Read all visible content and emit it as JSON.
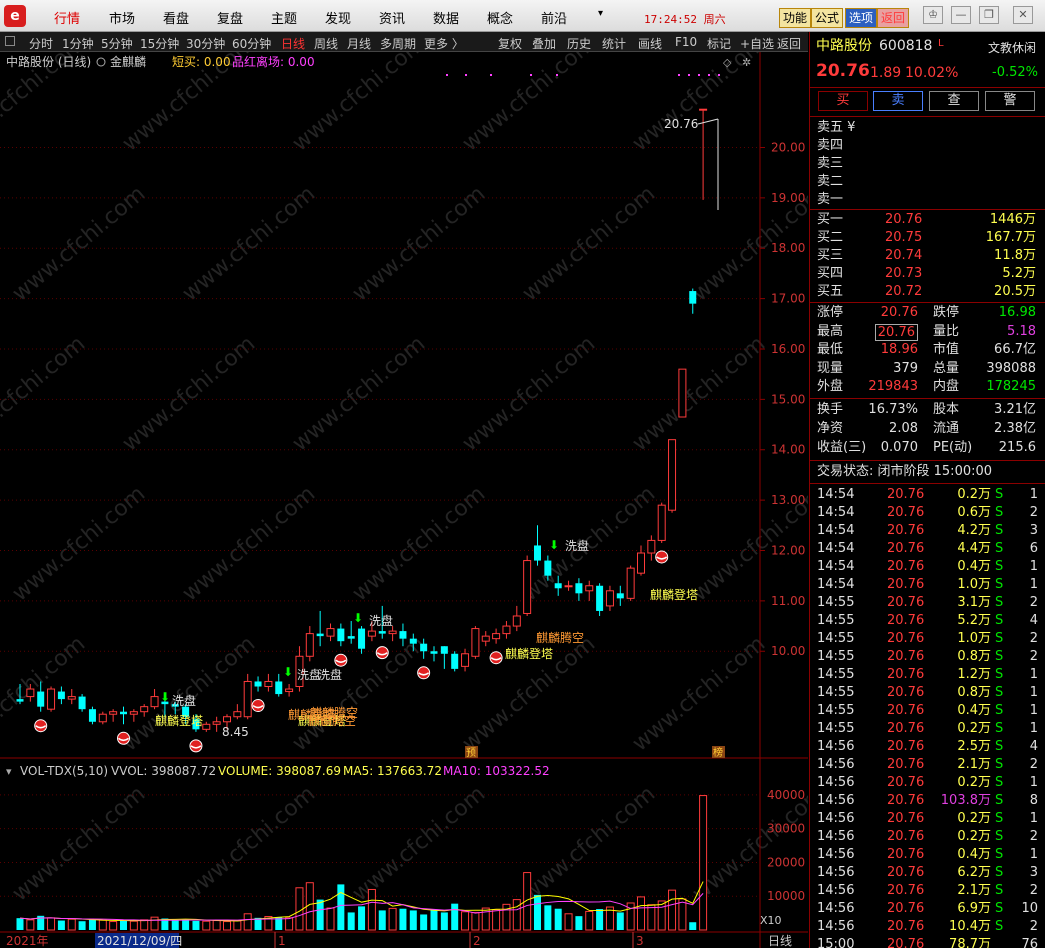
{
  "menu": {
    "logo": "e",
    "items": [
      "行情",
      "市场",
      "看盘",
      "复盘",
      "主题",
      "发现",
      "资讯",
      "数据",
      "概念",
      "前沿"
    ],
    "clock": "17:24:52 周六",
    "right_buttons": [
      "功能",
      "公式",
      "选项",
      "返回"
    ]
  },
  "toolbar": {
    "periods": [
      "分时",
      "1分钟",
      "5分钟",
      "15分钟",
      "30分钟",
      "60分钟",
      "日线",
      "周线",
      "月线",
      "多周期",
      "更多 〉"
    ],
    "tools": [
      "复权",
      "叠加",
      "历史",
      "统计",
      "画线",
      "F10",
      "标记",
      "+自选",
      "返回"
    ]
  },
  "chart_header": {
    "stock": "中路股份 (日线)",
    "indicator_name": "金麒麟",
    "short_buy_label": "短买: 0.00",
    "pinhong_label": "品红离场: 0.00"
  },
  "vol_header": {
    "name": "VOL-TDX(5,10)",
    "vvol": "VVOL: 398087.72",
    "volume": "VOLUME: 398087.69",
    "ma5": "MA5: 137663.72",
    "ma10": "MA10: 103322.52"
  },
  "x_axis": {
    "labels": [
      "2021年",
      "2021/12/09/四",
      "1",
      "2",
      "3"
    ],
    "right_label": "日线",
    "vol_unit": "X10"
  },
  "chart_data": [
    {
      "type": "candlestick",
      "title": "中路股份 (日线)",
      "y_ticks": [
        10.0,
        11.0,
        12.0,
        13.0,
        14.0,
        15.0,
        16.0,
        17.0,
        18.0,
        19.0,
        20.0
      ],
      "ylim": [
        8.0,
        21.3
      ],
      "candles": [
        {
          "o": 9.05,
          "c": 9.0,
          "h": 9.35,
          "l": 8.95
        },
        {
          "o": 9.1,
          "c": 9.25,
          "h": 9.35,
          "l": 9.0
        },
        {
          "o": 9.2,
          "c": 8.9,
          "h": 9.4,
          "l": 8.8
        },
        {
          "o": 8.85,
          "c": 9.25,
          "h": 9.3,
          "l": 8.8
        },
        {
          "o": 9.2,
          "c": 9.05,
          "h": 9.3,
          "l": 8.95
        },
        {
          "o": 9.05,
          "c": 9.1,
          "h": 9.25,
          "l": 8.95
        },
        {
          "o": 9.1,
          "c": 8.85,
          "h": 9.15,
          "l": 8.8
        },
        {
          "o": 8.85,
          "c": 8.6,
          "h": 8.9,
          "l": 8.55
        },
        {
          "o": 8.6,
          "c": 8.75,
          "h": 8.8,
          "l": 8.55
        },
        {
          "o": 8.75,
          "c": 8.8,
          "h": 8.85,
          "l": 8.6
        },
        {
          "o": 8.8,
          "c": 8.75,
          "h": 8.9,
          "l": 8.55
        },
        {
          "o": 8.75,
          "c": 8.8,
          "h": 8.85,
          "l": 8.6
        },
        {
          "o": 8.8,
          "c": 8.9,
          "h": 8.95,
          "l": 8.7
        },
        {
          "o": 8.9,
          "c": 9.1,
          "h": 9.25,
          "l": 8.85
        },
        {
          "o": 9.0,
          "c": 8.95,
          "h": 9.1,
          "l": 8.7
        },
        {
          "o": 8.95,
          "c": 8.9,
          "h": 9.0,
          "l": 8.75
        },
        {
          "o": 8.9,
          "c": 8.7,
          "h": 8.95,
          "l": 8.55
        },
        {
          "o": 8.65,
          "c": 8.45,
          "h": 8.75,
          "l": 8.4
        },
        {
          "o": 8.45,
          "c": 8.55,
          "h": 8.6,
          "l": 8.4
        },
        {
          "o": 8.55,
          "c": 8.6,
          "h": 8.7,
          "l": 8.4
        },
        {
          "o": 8.6,
          "c": 8.7,
          "h": 8.75,
          "l": 8.45
        },
        {
          "o": 8.7,
          "c": 8.8,
          "h": 8.95,
          "l": 8.65
        },
        {
          "o": 8.7,
          "c": 9.4,
          "h": 9.55,
          "l": 8.65
        },
        {
          "o": 9.4,
          "c": 9.3,
          "h": 9.5,
          "l": 9.2
        },
        {
          "o": 9.3,
          "c": 9.4,
          "h": 9.55,
          "l": 9.2
        },
        {
          "o": 9.4,
          "c": 9.15,
          "h": 9.55,
          "l": 9.1
        },
        {
          "o": 9.2,
          "c": 9.25,
          "h": 9.35,
          "l": 9.1
        },
        {
          "o": 9.3,
          "c": 9.9,
          "h": 10.1,
          "l": 9.2
        },
        {
          "o": 9.9,
          "c": 10.35,
          "h": 10.5,
          "l": 9.8
        },
        {
          "o": 10.35,
          "c": 10.3,
          "h": 10.8,
          "l": 10.1
        },
        {
          "o": 10.3,
          "c": 10.45,
          "h": 10.55,
          "l": 10.2
        },
        {
          "o": 10.45,
          "c": 10.2,
          "h": 10.55,
          "l": 10.1
        },
        {
          "o": 10.3,
          "c": 10.25,
          "h": 10.6,
          "l": 10.15
        },
        {
          "o": 10.45,
          "c": 10.05,
          "h": 10.5,
          "l": 9.95
        },
        {
          "o": 10.3,
          "c": 10.4,
          "h": 10.6,
          "l": 10.2
        },
        {
          "o": 10.4,
          "c": 10.35,
          "h": 10.9,
          "l": 10.25
        },
        {
          "o": 10.35,
          "c": 10.4,
          "h": 10.5,
          "l": 10.2
        },
        {
          "o": 10.4,
          "c": 10.25,
          "h": 10.55,
          "l": 10.1
        },
        {
          "o": 10.25,
          "c": 10.15,
          "h": 10.35,
          "l": 10.0
        },
        {
          "o": 10.15,
          "c": 10.0,
          "h": 10.25,
          "l": 9.85
        },
        {
          "o": 10.0,
          "c": 9.95,
          "h": 10.1,
          "l": 9.8
        },
        {
          "o": 10.1,
          "c": 9.95,
          "h": 10.1,
          "l": 9.65
        },
        {
          "o": 9.95,
          "c": 9.65,
          "h": 10.0,
          "l": 9.6
        },
        {
          "o": 9.7,
          "c": 9.95,
          "h": 10.05,
          "l": 9.6
        },
        {
          "o": 9.9,
          "c": 10.45,
          "h": 10.5,
          "l": 9.85
        },
        {
          "o": 10.2,
          "c": 10.3,
          "h": 10.4,
          "l": 10.1
        },
        {
          "o": 10.25,
          "c": 10.35,
          "h": 10.45,
          "l": 10.15
        },
        {
          "o": 10.35,
          "c": 10.5,
          "h": 10.6,
          "l": 10.25
        },
        {
          "o": 10.5,
          "c": 10.7,
          "h": 10.9,
          "l": 10.4
        },
        {
          "o": 10.75,
          "c": 11.8,
          "h": 11.9,
          "l": 10.7
        },
        {
          "o": 12.1,
          "c": 11.8,
          "h": 12.5,
          "l": 11.7
        },
        {
          "o": 11.8,
          "c": 11.5,
          "h": 11.9,
          "l": 11.4
        },
        {
          "o": 11.35,
          "c": 11.25,
          "h": 11.5,
          "l": 11.1
        },
        {
          "o": 11.3,
          "c": 11.3,
          "h": 11.4,
          "l": 11.2
        },
        {
          "o": 11.35,
          "c": 11.15,
          "h": 11.45,
          "l": 11.0
        },
        {
          "o": 11.2,
          "c": 11.3,
          "h": 11.4,
          "l": 11.0
        },
        {
          "o": 11.3,
          "c": 10.8,
          "h": 11.35,
          "l": 10.7
        },
        {
          "o": 10.9,
          "c": 11.2,
          "h": 11.3,
          "l": 10.8
        },
        {
          "o": 11.15,
          "c": 11.05,
          "h": 11.3,
          "l": 10.9
        },
        {
          "o": 11.05,
          "c": 11.65,
          "h": 11.7,
          "l": 11.0
        },
        {
          "o": 11.55,
          "c": 11.95,
          "h": 12.1,
          "l": 11.5
        },
        {
          "o": 11.95,
          "c": 12.2,
          "h": 12.3,
          "l": 11.8
        },
        {
          "o": 12.2,
          "c": 12.9,
          "h": 12.95,
          "l": 12.15
        },
        {
          "o": 12.8,
          "c": 14.2,
          "h": 14.2,
          "l": 12.75
        },
        {
          "o": 14.65,
          "c": 15.6,
          "h": 15.6,
          "l": 14.65
        },
        {
          "o": 17.15,
          "c": 16.9,
          "h": 17.2,
          "l": 16.7
        },
        {
          "o": 20.76,
          "c": 20.76,
          "h": 20.76,
          "l": 18.96
        }
      ],
      "annotations": [
        "洗盘",
        "洗盘",
        "洗盘",
        "洗盘",
        "洗盘",
        "麒麟登塔",
        "麒麟登塔",
        "麒麟登塔",
        "麒麟登塔",
        "麒麟登塔",
        "麒麟腾空",
        "麒麟腾空",
        "麒麟腾空",
        "8.45",
        "20.76",
        "预",
        "榜"
      ]
    },
    {
      "type": "bar",
      "title": "VOL-TDX(5,10)",
      "y_ticks": [
        10000,
        20000,
        30000,
        40000
      ],
      "ylim": [
        0,
        45000
      ],
      "values": [
        3500,
        3000,
        4200,
        3600,
        2800,
        3200,
        2600,
        3100,
        2900,
        2500,
        2800,
        2600,
        3000,
        3800,
        3400,
        2900,
        3000,
        2700,
        2600,
        2800,
        2500,
        2700,
        4800,
        3600,
        4000,
        3800,
        3600,
        12500,
        14000,
        9000,
        6500,
        13500,
        5200,
        7000,
        12000,
        5800,
        6400,
        6300,
        5800,
        4600,
        6100,
        5200,
        7800,
        5400,
        5200,
        6500,
        6000,
        7600,
        9000,
        17000,
        10400,
        7300,
        6300,
        4800,
        4100,
        5500,
        6200,
        6800,
        5200,
        8000,
        9800,
        7500,
        8600,
        11800,
        9200,
        2300,
        39800
      ],
      "series": [
        {
          "name": "MA5",
          "color": "#ffff00",
          "values": [
            3500,
            3250,
            3570,
            3575,
            3420,
            3360,
            3240,
            3060,
            2920,
            2860,
            2800,
            2760,
            2760,
            2940,
            3100,
            3140,
            3220,
            3160,
            2920,
            2800,
            2720,
            2660,
            3080,
            3240,
            3520,
            3780,
            3960,
            5560,
            7580,
            8100,
            9120,
            11100,
            9640,
            8240,
            8840,
            8700,
            7080,
            7500,
            6860,
            6140,
            5840,
            5680,
            6100,
            5800,
            5860,
            5860,
            6140,
            6180,
            6860,
            8860,
            10000,
            10220,
            9920,
            9220,
            7580,
            5800,
            5780,
            5880,
            5580,
            6340,
            7200,
            7340,
            7560,
            9140,
            9380,
            7880,
            14340
          ]
        },
        {
          "name": "MA10",
          "color": "#ff40ff",
          "values": [
            3500,
            3250,
            3570,
            3575,
            3420,
            3390,
            3280,
            3245,
            3205,
            3140,
            3020,
            2980,
            2900,
            2880,
            2930,
            2900,
            2940,
            2950,
            2930,
            2960,
            2960,
            2940,
            3120,
            3200,
            3250,
            3300,
            3360,
            4280,
            5390,
            5990,
            6350,
            7290,
            7350,
            7470,
            8210,
            7900,
            8100,
            7470,
            6550,
            6330,
            6100,
            5880,
            6070,
            5660,
            5000,
            5350,
            5680,
            5960,
            6000,
            7270,
            7780,
            8160,
            8420,
            8480,
            8360,
            8300,
            8310,
            8550,
            7750,
            6390,
            6540,
            6630,
            6740,
            7510,
            8240,
            7490,
            10850
          ]
        },
        {
          "name": "VOLUME",
          "values": [
            398087.69
          ]
        },
        {
          "name": "VVOL",
          "values": [
            398087.72
          ]
        }
      ]
    }
  ],
  "quote": {
    "name": "中路股份",
    "code": "600818",
    "flag": "L",
    "price": "20.76",
    "change": "1.89",
    "pct": "10.02%",
    "sector": "文教休闲",
    "sector_pct": "-0.52%",
    "buttons": [
      "买",
      "卖",
      "查",
      "警"
    ],
    "asks": [
      {
        "label": "卖五 ¥",
        "price": "",
        "vol": ""
      },
      {
        "label": "卖四",
        "price": "",
        "vol": ""
      },
      {
        "label": "卖三",
        "price": "",
        "vol": ""
      },
      {
        "label": "卖二",
        "price": "",
        "vol": ""
      },
      {
        "label": "卖一",
        "price": "",
        "vol": ""
      }
    ],
    "bids": [
      {
        "label": "买一",
        "price": "20.76",
        "vol": "1446万"
      },
      {
        "label": "买二",
        "price": "20.75",
        "vol": "167.7万"
      },
      {
        "label": "买三",
        "price": "20.74",
        "vol": "11.8万"
      },
      {
        "label": "买四",
        "price": "20.73",
        "vol": "5.2万"
      },
      {
        "label": "买五",
        "price": "20.72",
        "vol": "20.5万"
      }
    ],
    "stats": [
      {
        "l1": "涨停",
        "v1": "20.76",
        "c1": "red",
        "l2": "跌停",
        "v2": "16.98",
        "c2": "green"
      },
      {
        "l1": "最高",
        "v1": "20.76",
        "c1": "red",
        "l2": "量比",
        "v2": "5.18",
        "c2": "mag"
      },
      {
        "l1": "最低",
        "v1": "18.96",
        "c1": "red",
        "l2": "市值",
        "v2": "66.7亿",
        "c2": "wht"
      },
      {
        "l1": "现量",
        "v1": "379",
        "c1": "wht",
        "l2": "总量",
        "v2": "398088",
        "c2": "wht"
      },
      {
        "l1": "外盘",
        "v1": "219843",
        "c1": "red",
        "l2": "内盘",
        "v2": "178245",
        "c2": "green"
      }
    ],
    "stats2": [
      {
        "l1": "换手",
        "v1": "16.73%",
        "l2": "股本",
        "v2": "3.21亿"
      },
      {
        "l1": "净资",
        "v1": "2.08",
        "l2": "流通",
        "v2": "2.38亿"
      },
      {
        "l1": "收益(三)",
        "v1": "0.070",
        "l2": "PE(动)",
        "v2": "215.6"
      }
    ],
    "trade_status": "交易状态: 闭市阶段 15:00:00",
    "ticks": [
      {
        "t": "14:54",
        "p": "20.76",
        "v": "0.2万",
        "s": "S",
        "n": "1"
      },
      {
        "t": "14:54",
        "p": "20.76",
        "v": "0.6万",
        "s": "S",
        "n": "2"
      },
      {
        "t": "14:54",
        "p": "20.76",
        "v": "4.2万",
        "s": "S",
        "n": "3"
      },
      {
        "t": "14:54",
        "p": "20.76",
        "v": "4.4万",
        "s": "S",
        "n": "6"
      },
      {
        "t": "14:54",
        "p": "20.76",
        "v": "0.4万",
        "s": "S",
        "n": "1"
      },
      {
        "t": "14:54",
        "p": "20.76",
        "v": "1.0万",
        "s": "S",
        "n": "1"
      },
      {
        "t": "14:55",
        "p": "20.76",
        "v": "3.1万",
        "s": "S",
        "n": "2"
      },
      {
        "t": "14:55",
        "p": "20.76",
        "v": "5.2万",
        "s": "S",
        "n": "4"
      },
      {
        "t": "14:55",
        "p": "20.76",
        "v": "1.0万",
        "s": "S",
        "n": "2"
      },
      {
        "t": "14:55",
        "p": "20.76",
        "v": "0.8万",
        "s": "S",
        "n": "2"
      },
      {
        "t": "14:55",
        "p": "20.76",
        "v": "1.2万",
        "s": "S",
        "n": "1"
      },
      {
        "t": "14:55",
        "p": "20.76",
        "v": "0.8万",
        "s": "S",
        "n": "1"
      },
      {
        "t": "14:55",
        "p": "20.76",
        "v": "0.4万",
        "s": "S",
        "n": "1"
      },
      {
        "t": "14:55",
        "p": "20.76",
        "v": "0.2万",
        "s": "S",
        "n": "1"
      },
      {
        "t": "14:56",
        "p": "20.76",
        "v": "2.5万",
        "s": "S",
        "n": "4"
      },
      {
        "t": "14:56",
        "p": "20.76",
        "v": "2.1万",
        "s": "S",
        "n": "2"
      },
      {
        "t": "14:56",
        "p": "20.76",
        "v": "0.2万",
        "s": "S",
        "n": "1"
      },
      {
        "t": "14:56",
        "p": "20.76",
        "v": "103.8万",
        "s": "S",
        "n": "8"
      },
      {
        "t": "14:56",
        "p": "20.76",
        "v": "0.2万",
        "s": "S",
        "n": "1"
      },
      {
        "t": "14:56",
        "p": "20.76",
        "v": "0.2万",
        "s": "S",
        "n": "2"
      },
      {
        "t": "14:56",
        "p": "20.76",
        "v": "0.4万",
        "s": "S",
        "n": "1"
      },
      {
        "t": "14:56",
        "p": "20.76",
        "v": "6.2万",
        "s": "S",
        "n": "3"
      },
      {
        "t": "14:56",
        "p": "20.76",
        "v": "2.1万",
        "s": "S",
        "n": "2"
      },
      {
        "t": "14:56",
        "p": "20.76",
        "v": "6.9万",
        "s": "S",
        "n": "10"
      },
      {
        "t": "14:56",
        "p": "20.76",
        "v": "10.4万",
        "s": "S",
        "n": "2"
      },
      {
        "t": "15:00",
        "p": "20.76",
        "v": "78.7万",
        "s": "",
        "n": "76"
      }
    ]
  },
  "watermark": "www.cfchi.com",
  "colors": {
    "up": "#ff3b3b",
    "down": "#00ffff",
    "grid": "#7a0000",
    "ma5": "#ffff00",
    "ma10": "#ff40ff"
  }
}
